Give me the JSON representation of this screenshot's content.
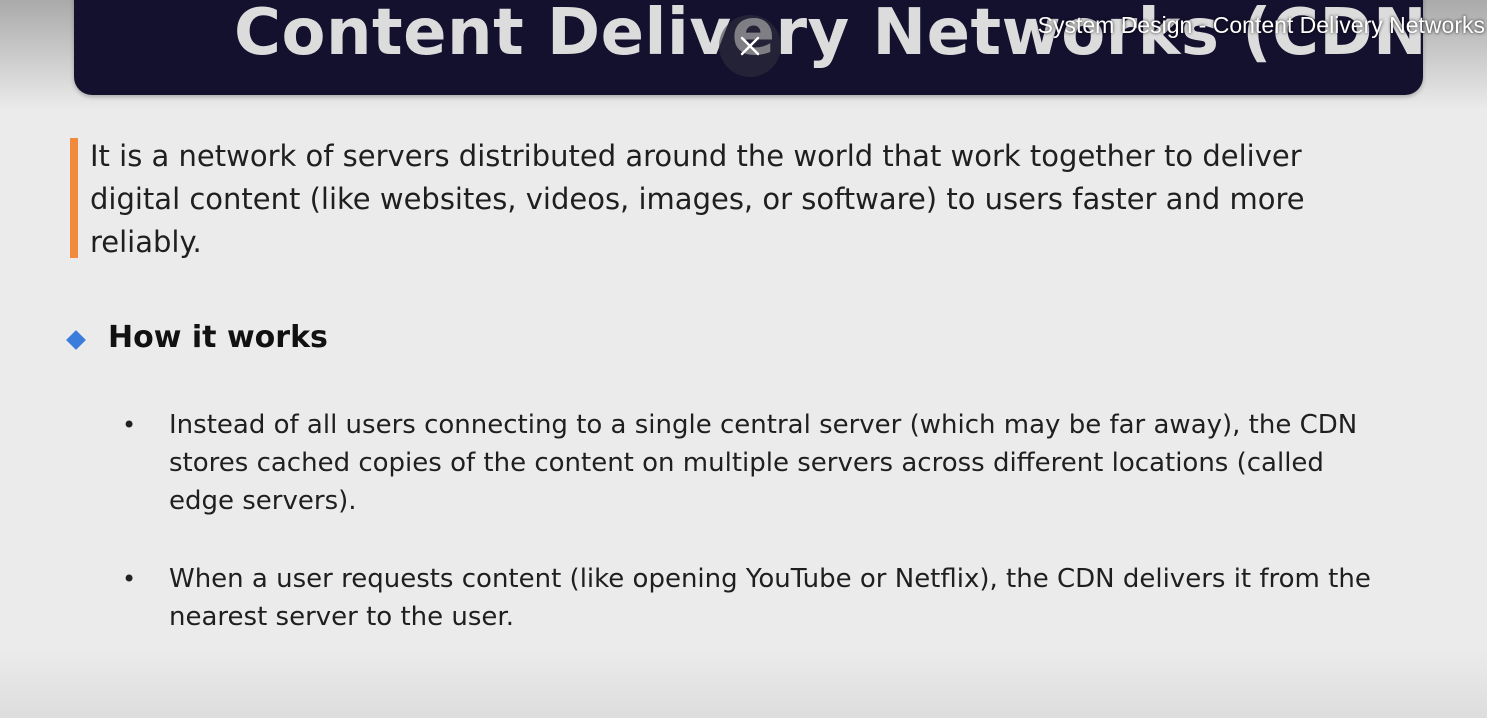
{
  "video": {
    "title": "System Design - Content Delivery Networks"
  },
  "slide": {
    "title": "Content Delivery Networks (CDNs)",
    "definition": "It is a network of servers distributed around the world that work together to deliver digital content (like websites, videos, images, or software) to users faster and more reliably.",
    "section_heading": "How it works",
    "bullets": [
      "Instead of all users connecting to a single central server (which may be far away), the CDN stores cached copies of the content on multiple servers across different locations (called edge servers).",
      "When a user requests content (like opening YouTube or Netflix), the CDN delivers it from the nearest server to the user."
    ]
  },
  "icons": {
    "close": "close-icon",
    "section_marker": "diamond-icon",
    "bullet": "bullet-icon"
  },
  "colors": {
    "banner": "#14112f",
    "quote_bar": "#f28a3d",
    "diamond": "#3b7ddd",
    "background": "#ebebeb"
  }
}
